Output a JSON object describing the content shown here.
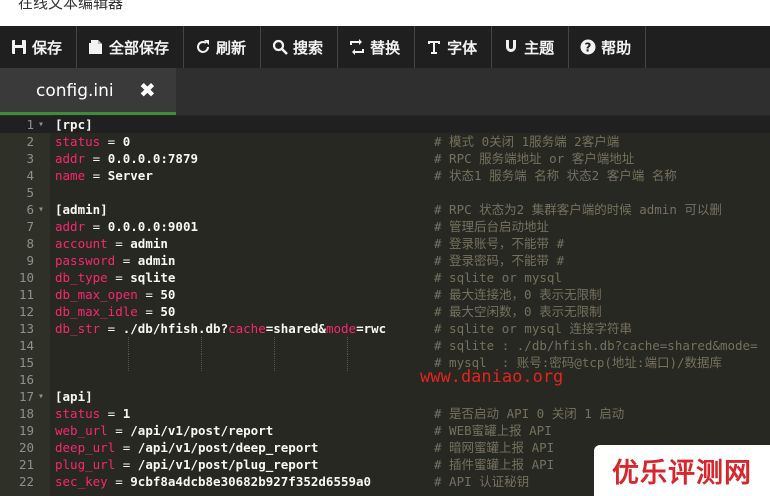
{
  "window": {
    "title": "在线文本编辑器"
  },
  "toolbar": {
    "buttons": [
      {
        "icon": "save-icon",
        "label": "保存"
      },
      {
        "icon": "save-all-icon",
        "label": "全部保存"
      },
      {
        "icon": "refresh-icon",
        "label": "刷新"
      },
      {
        "icon": "search-icon",
        "label": "搜索"
      },
      {
        "icon": "replace-icon",
        "label": "替换"
      },
      {
        "icon": "font-icon",
        "label": "字体"
      },
      {
        "icon": "theme-icon",
        "label": "主题"
      },
      {
        "icon": "help-icon",
        "label": "帮助"
      }
    ]
  },
  "tab": {
    "name": "config.ini",
    "close": "✖"
  },
  "editor": {
    "lines": [
      {
        "n": "1",
        "fold": true,
        "tokens": [
          [
            "b",
            "[rpc]"
          ]
        ],
        "comment": ""
      },
      {
        "n": "2",
        "tokens": [
          [
            "k",
            "status"
          ],
          [
            "w",
            " = "
          ],
          [
            "b",
            "0"
          ]
        ],
        "comment": "# 模式 0关闭 1服务端 2客户端"
      },
      {
        "n": "3",
        "tokens": [
          [
            "k",
            "addr"
          ],
          [
            "w",
            " = "
          ],
          [
            "b",
            "0.0.0.0:7879"
          ]
        ],
        "comment": "# RPC 服务端地址 or 客户端地址"
      },
      {
        "n": "4",
        "tokens": [
          [
            "k",
            "name"
          ],
          [
            "w",
            " = "
          ],
          [
            "b",
            "Server"
          ]
        ],
        "comment": "# 状态1 服务端 名称 状态2 客户端 名称"
      },
      {
        "n": "5",
        "tokens": [],
        "comment": ""
      },
      {
        "n": "6",
        "fold": true,
        "tokens": [
          [
            "b",
            "[admin]"
          ]
        ],
        "comment": "# RPC 状态为2 集群客户端的时候 admin 可以删"
      },
      {
        "n": "7",
        "tokens": [
          [
            "k",
            "addr"
          ],
          [
            "w",
            " = "
          ],
          [
            "b",
            "0.0.0.0:9001"
          ]
        ],
        "comment": "# 管理后台启动地址"
      },
      {
        "n": "8",
        "tokens": [
          [
            "k",
            "account"
          ],
          [
            "w",
            " = "
          ],
          [
            "b",
            "admin"
          ]
        ],
        "comment": "# 登录账号，不能带 #"
      },
      {
        "n": "9",
        "tokens": [
          [
            "k",
            "password"
          ],
          [
            "w",
            " = "
          ],
          [
            "b",
            "admin"
          ]
        ],
        "comment": "# 登录密码，不能带 #"
      },
      {
        "n": "10",
        "tokens": [
          [
            "k",
            "db_type"
          ],
          [
            "w",
            " = "
          ],
          [
            "b",
            "sqlite"
          ]
        ],
        "comment": "# sqlite or mysql"
      },
      {
        "n": "11",
        "tokens": [
          [
            "k",
            "db_max_open"
          ],
          [
            "w",
            " = "
          ],
          [
            "b",
            "50"
          ]
        ],
        "comment": "# 最大连接池，0 表示无限制"
      },
      {
        "n": "12",
        "tokens": [
          [
            "k",
            "db_max_idle"
          ],
          [
            "w",
            " = "
          ],
          [
            "b",
            "50"
          ]
        ],
        "comment": "# 最大空闲数，0 表示无限制"
      },
      {
        "n": "13",
        "tokens": [
          [
            "k",
            "db_str"
          ],
          [
            "w",
            " = "
          ],
          [
            "b",
            "./db/hfish.db?"
          ],
          [
            "k",
            "cache"
          ],
          [
            "b",
            "=shared&"
          ],
          [
            "k",
            "mode"
          ],
          [
            "b",
            "=rwc"
          ]
        ],
        "comment": "# sqlite or mysql 连接字符串"
      },
      {
        "n": "14",
        "tokens": [],
        "comment": "# sqlite : ./db/hfish.db?cache=shared&mode="
      },
      {
        "n": "15",
        "tokens": [],
        "comment": "# mysql  : 账号:密码@tcp(地址:端口)/数据库"
      },
      {
        "n": "16",
        "tokens": [],
        "comment": ""
      },
      {
        "n": "17",
        "fold": true,
        "tokens": [
          [
            "b",
            "[api]"
          ]
        ],
        "comment": ""
      },
      {
        "n": "18",
        "tokens": [
          [
            "k",
            "status"
          ],
          [
            "w",
            " = "
          ],
          [
            "b",
            "1"
          ]
        ],
        "comment": "# 是否启动 API 0 关闭 1 启动"
      },
      {
        "n": "19",
        "tokens": [
          [
            "k",
            "web_url"
          ],
          [
            "w",
            " = "
          ],
          [
            "b",
            "/api/v1/post/report"
          ]
        ],
        "comment": "# WEB蜜罐上报 API"
      },
      {
        "n": "20",
        "tokens": [
          [
            "k",
            "deep_url"
          ],
          [
            "w",
            " = "
          ],
          [
            "b",
            "/api/v1/post/deep_report"
          ]
        ],
        "comment": "# 暗网蜜罐上报 API"
      },
      {
        "n": "21",
        "tokens": [
          [
            "k",
            "plug_url"
          ],
          [
            "w",
            " = "
          ],
          [
            "b",
            "/api/v1/post/plug_report"
          ]
        ],
        "comment": "# 插件蜜罐上报 API"
      },
      {
        "n": "22",
        "tokens": [
          [
            "k",
            "sec_key"
          ],
          [
            "w",
            " = "
          ],
          [
            "b",
            "9cbf8a4dcb8e30682b927f352d6559a0"
          ]
        ],
        "comment": "# API 认证秘钥"
      }
    ]
  },
  "watermark": {
    "text": "www.daniao.org"
  },
  "logo": {
    "text": "优乐评测网"
  },
  "colors": {
    "background": "#272822",
    "key": "#f92672",
    "comment": "#75715e",
    "watermark": "#e8231c",
    "tab_accent": "#3b8d3b"
  }
}
